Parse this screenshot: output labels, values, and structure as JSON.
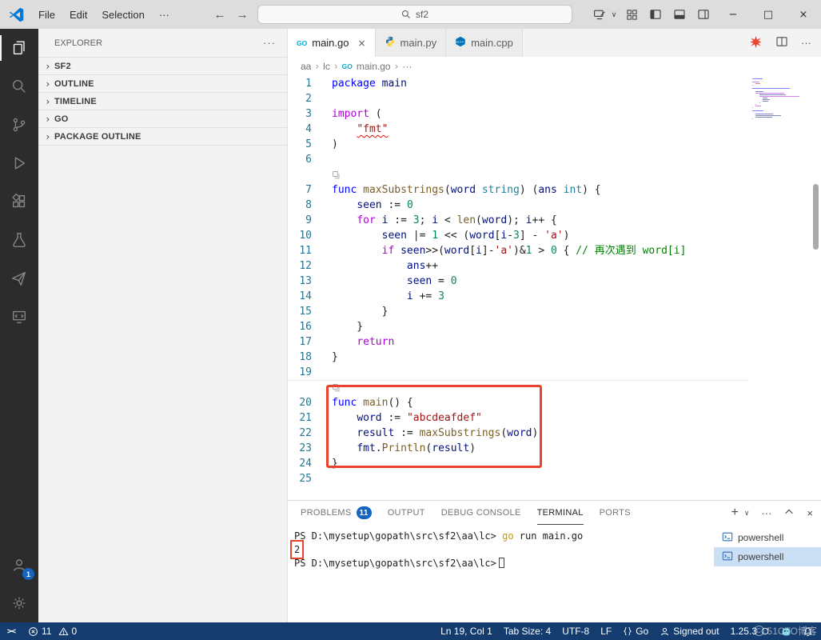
{
  "window": {
    "menus": [
      "File",
      "Edit",
      "Selection"
    ],
    "search_value": "sf2"
  },
  "icons": {
    "ellipsis": "···",
    "chevron_down": "∨",
    "back": "←",
    "forward": "→",
    "close": "×",
    "minimize": "−",
    "maximize": "□",
    "plus": "+",
    "crumb_sep": "›",
    "go_badge": "GO",
    "remote": "><",
    "wm_mark": "C"
  },
  "sidebar": {
    "title": "EXPLORER",
    "sections": [
      "SF2",
      "OUTLINE",
      "TIMELINE",
      "GO",
      "PACKAGE OUTLINE"
    ]
  },
  "activity_bar": {
    "account_badge": "1"
  },
  "tabs": [
    {
      "label": "main.go",
      "icon": "go",
      "active": true,
      "closable": true
    },
    {
      "label": "main.py",
      "icon": "python"
    },
    {
      "label": "main.cpp",
      "icon": "cpp"
    }
  ],
  "breadcrumb": [
    {
      "label": "aa"
    },
    {
      "label": "lc"
    },
    {
      "label": "main.go",
      "icon": "go"
    },
    {
      "label": "···"
    }
  ],
  "editor": {
    "lines": [
      {
        "n": 1,
        "t": [
          [
            "package",
            "k"
          ],
          [
            " ",
            "p"
          ],
          [
            "main",
            "v"
          ]
        ]
      },
      {
        "n": 2,
        "t": []
      },
      {
        "n": 3,
        "t": [
          [
            "import",
            "c"
          ],
          [
            " (",
            "p"
          ]
        ]
      },
      {
        "n": 4,
        "t": [
          [
            "    ",
            "p"
          ],
          [
            "\"fmt\"",
            "s",
            "u"
          ]
        ]
      },
      {
        "n": 5,
        "t": [
          [
            ")",
            "p"
          ]
        ]
      },
      {
        "n": 6,
        "t": []
      },
      {
        "n": 7,
        "lens": true,
        "t": [
          [
            "func",
            "k"
          ],
          [
            " ",
            "p"
          ],
          [
            "maxSubstrings",
            "f"
          ],
          [
            "(",
            "p"
          ],
          [
            "word",
            "v"
          ],
          [
            " ",
            "p"
          ],
          [
            "string",
            "y"
          ],
          [
            ") (",
            "p"
          ],
          [
            "ans",
            "v"
          ],
          [
            " ",
            "p"
          ],
          [
            "int",
            "y"
          ],
          [
            ") {",
            "p"
          ]
        ]
      },
      {
        "n": 8,
        "t": [
          [
            "    ",
            "p"
          ],
          [
            "seen",
            "v"
          ],
          [
            " := ",
            "p"
          ],
          [
            "0",
            "n"
          ]
        ]
      },
      {
        "n": 9,
        "t": [
          [
            "    ",
            "p"
          ],
          [
            "for",
            "c"
          ],
          [
            " ",
            "p"
          ],
          [
            "i",
            "v"
          ],
          [
            " := ",
            "p"
          ],
          [
            "3",
            "n"
          ],
          [
            "; ",
            "p"
          ],
          [
            "i",
            "v"
          ],
          [
            " < ",
            "p"
          ],
          [
            "len",
            "f"
          ],
          [
            "(",
            "p"
          ],
          [
            "word",
            "v"
          ],
          [
            "); ",
            "p"
          ],
          [
            "i",
            "v"
          ],
          [
            "++ {",
            "p"
          ]
        ]
      },
      {
        "n": 10,
        "t": [
          [
            "        ",
            "p"
          ],
          [
            "seen",
            "v"
          ],
          [
            " |= ",
            "p"
          ],
          [
            "1",
            "n"
          ],
          [
            " << (",
            "p"
          ],
          [
            "word",
            "v"
          ],
          [
            "[",
            "p"
          ],
          [
            "i",
            "v"
          ],
          [
            "-",
            "p"
          ],
          [
            "3",
            "n"
          ],
          [
            "] - ",
            "p"
          ],
          [
            "'a'",
            "s"
          ],
          [
            ")",
            "p"
          ]
        ]
      },
      {
        "n": 11,
        "t": [
          [
            "        ",
            "p"
          ],
          [
            "if",
            "c"
          ],
          [
            " ",
            "p"
          ],
          [
            "seen",
            "v"
          ],
          [
            ">>(",
            "p"
          ],
          [
            "word",
            "v"
          ],
          [
            "[",
            "p"
          ],
          [
            "i",
            "v"
          ],
          [
            "]-",
            "p"
          ],
          [
            "'a'",
            "s"
          ],
          [
            ")&",
            "p"
          ],
          [
            "1",
            "n"
          ],
          [
            " > ",
            "p"
          ],
          [
            "0",
            "n"
          ],
          [
            " { ",
            "p"
          ],
          [
            "// 再次遇到 word[i]",
            "m"
          ]
        ]
      },
      {
        "n": 12,
        "t": [
          [
            "            ",
            "p"
          ],
          [
            "ans",
            "v"
          ],
          [
            "++",
            "p"
          ]
        ]
      },
      {
        "n": 13,
        "t": [
          [
            "            ",
            "p"
          ],
          [
            "seen",
            "v"
          ],
          [
            " = ",
            "p"
          ],
          [
            "0",
            "n"
          ]
        ]
      },
      {
        "n": 14,
        "t": [
          [
            "            ",
            "p"
          ],
          [
            "i",
            "v"
          ],
          [
            " += ",
            "p"
          ],
          [
            "3",
            "n"
          ]
        ]
      },
      {
        "n": 15,
        "t": [
          [
            "        }",
            "p"
          ]
        ]
      },
      {
        "n": 16,
        "t": [
          [
            "    }",
            "p"
          ]
        ]
      },
      {
        "n": 17,
        "t": [
          [
            "    ",
            "p"
          ],
          [
            "return",
            "c"
          ]
        ]
      },
      {
        "n": 18,
        "t": [
          [
            "}",
            "p"
          ]
        ]
      },
      {
        "n": 19,
        "t": []
      },
      {
        "n": 20,
        "lens": true,
        "hline": true,
        "t": [
          [
            "func",
            "k"
          ],
          [
            " ",
            "p"
          ],
          [
            "main",
            "f"
          ],
          [
            "() {",
            "p"
          ]
        ]
      },
      {
        "n": 21,
        "t": [
          [
            "    ",
            "p"
          ],
          [
            "word",
            "v"
          ],
          [
            " := ",
            "p"
          ],
          [
            "\"abcdeafdef\"",
            "s"
          ]
        ]
      },
      {
        "n": 22,
        "t": [
          [
            "    ",
            "p"
          ],
          [
            "result",
            "v"
          ],
          [
            " := ",
            "p"
          ],
          [
            "maxSubstrings",
            "f"
          ],
          [
            "(",
            "p"
          ],
          [
            "word",
            "v"
          ],
          [
            ")",
            "p"
          ]
        ]
      },
      {
        "n": 23,
        "t": [
          [
            "    ",
            "p"
          ],
          [
            "fmt",
            "v"
          ],
          [
            ".",
            "p"
          ],
          [
            "Println",
            "f"
          ],
          [
            "(",
            "p"
          ],
          [
            "result",
            "v"
          ],
          [
            ")",
            "p"
          ]
        ]
      },
      {
        "n": 24,
        "t": [
          [
            "}",
            "p"
          ]
        ]
      },
      {
        "n": 25,
        "t": []
      }
    ]
  },
  "panel": {
    "tabs": [
      {
        "label": "PROBLEMS",
        "badge": "11"
      },
      {
        "label": "OUTPUT"
      },
      {
        "label": "DEBUG CONSOLE"
      },
      {
        "label": "TERMINAL",
        "active": true
      },
      {
        "label": "PORTS"
      }
    ],
    "terminal": {
      "lines": [
        {
          "type": "cmd",
          "prompt": "PS D:\\mysetup\\gopath\\src\\sf2\\aa\\lc>",
          "cmd": "go",
          "args": " run main.go"
        },
        {
          "type": "out",
          "text": "2",
          "boxed": true
        },
        {
          "type": "cmd",
          "prompt": "PS D:\\mysetup\\gopath\\src\\sf2\\aa\\lc>",
          "cursor": true
        }
      ],
      "list": [
        {
          "label": "powershell"
        },
        {
          "label": "powershell",
          "selected": true
        }
      ]
    }
  },
  "status_bar": {
    "errors": "11",
    "warnings": "0",
    "ln_col": "Ln 19, Col 1",
    "tab_size": "Tab Size: 4",
    "encoding": "UTF-8",
    "eol": "LF",
    "language": "Go",
    "account": "Signed out",
    "version": "1.25.3"
  },
  "watermark": "51CTO博客",
  "colors": {
    "annotation_red": "#e8432d",
    "status_bar_bg": "#143c6e",
    "badge_blue": "#1565c0",
    "activity_bar_bg": "#2c2c2c"
  }
}
